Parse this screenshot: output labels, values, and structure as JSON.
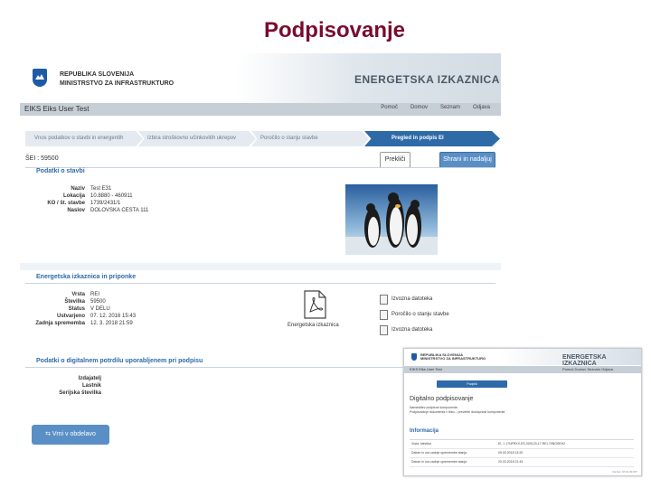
{
  "slide": {
    "title": "Podpisovanje"
  },
  "colors": {
    "title": "#7a0c2e",
    "accent": "#2e6aa8",
    "button": "#5a8fc6"
  },
  "app": {
    "ministry_line1": "REPUBLIKA SLOVENIJA",
    "ministry_line2": "MINISTRSTVO ZA INFRASTRUKTURO",
    "brand": "ENERGETSKA IZKAZNICA",
    "user": "EIKS Eiks User Test",
    "links": [
      "Pomoč",
      "Domov",
      "Seznam",
      "Odjava"
    ]
  },
  "steps": [
    "Vnos podatkov o stavbi in energentih",
    "Izbira stroškovno učinkovitih ukrepov",
    "Poročilo o stanju stavbe",
    "Pregled in podpis EI"
  ],
  "ei_label": "ŠEI : 59500",
  "buttons": {
    "cancel": "Prekliči",
    "save_continue": "Shrani in nadaljuj",
    "return_to_edit": "Vrni v obdelavo"
  },
  "building": {
    "section_title": "Podatki o stavbi",
    "fields": [
      {
        "key": "Naziv",
        "value": "Test E31"
      },
      {
        "key": "Lokacija",
        "value": "10.8880 - 460911"
      },
      {
        "key": "KO / št. stavbe",
        "value": "1739/2431/1"
      },
      {
        "key": "Naslov",
        "value": "DOLOVSKA CESTA 111"
      }
    ]
  },
  "certificate": {
    "section_title": "Energetska izkaznica in priponke",
    "fields": [
      {
        "key": "Vrsta",
        "value": "REI"
      },
      {
        "key": "Številka",
        "value": "59500"
      },
      {
        "key": "Status",
        "value": "V DELU"
      },
      {
        "key": "Ustvarjeno",
        "value": "07. 12. 2016 15:43"
      },
      {
        "key": "Zadnja sprememba",
        "value": "12. 3. 2018 21:59"
      }
    ],
    "pdf_caption": "Energetska izkaznica",
    "files": [
      "Izvozna datoteka",
      "Poročilo o stanju stavbe",
      "Izvozna datoteka"
    ]
  },
  "signature": {
    "section_title": "Podatki o digitalnem potrdilu uporabljenem pri podpisu",
    "fields": [
      "Izdajatelj",
      "Lastnik",
      "Serijska številka"
    ]
  },
  "inset": {
    "ministry_line1": "REPUBLIKA SLOVENIJA",
    "ministry_line2": "MINISTRSTVO ZA INFRASTRUKTURO",
    "brand": "ENERGETSKA IZKAZNICA",
    "user": "EIKS Eiks User Test",
    "links": "Pomoč  Domov  Seznam  Odjava",
    "button": "Podpiši",
    "title": "Digitalno podpisovanje",
    "text1": "Namestitev podpisne komponente",
    "text2": "Podpisovanje dokumenta v teku... preverite dostopnost komponente",
    "info_title": "Informacija",
    "rows": [
      {
        "k": "Vrsta, številka",
        "v": "EI, 1 17NFRXX-ES-000123-17-REI-79NOSEH2"
      },
      {
        "k": "Datum in ura zadnje spremembe stanja",
        "v": "09.03.2018 13:20"
      },
      {
        "k": "Datum in ura zadnje spremembe stanja",
        "v": "20.03.2018 21:43"
      }
    ],
    "footer": "Verzija: 18.01.09.INT"
  }
}
